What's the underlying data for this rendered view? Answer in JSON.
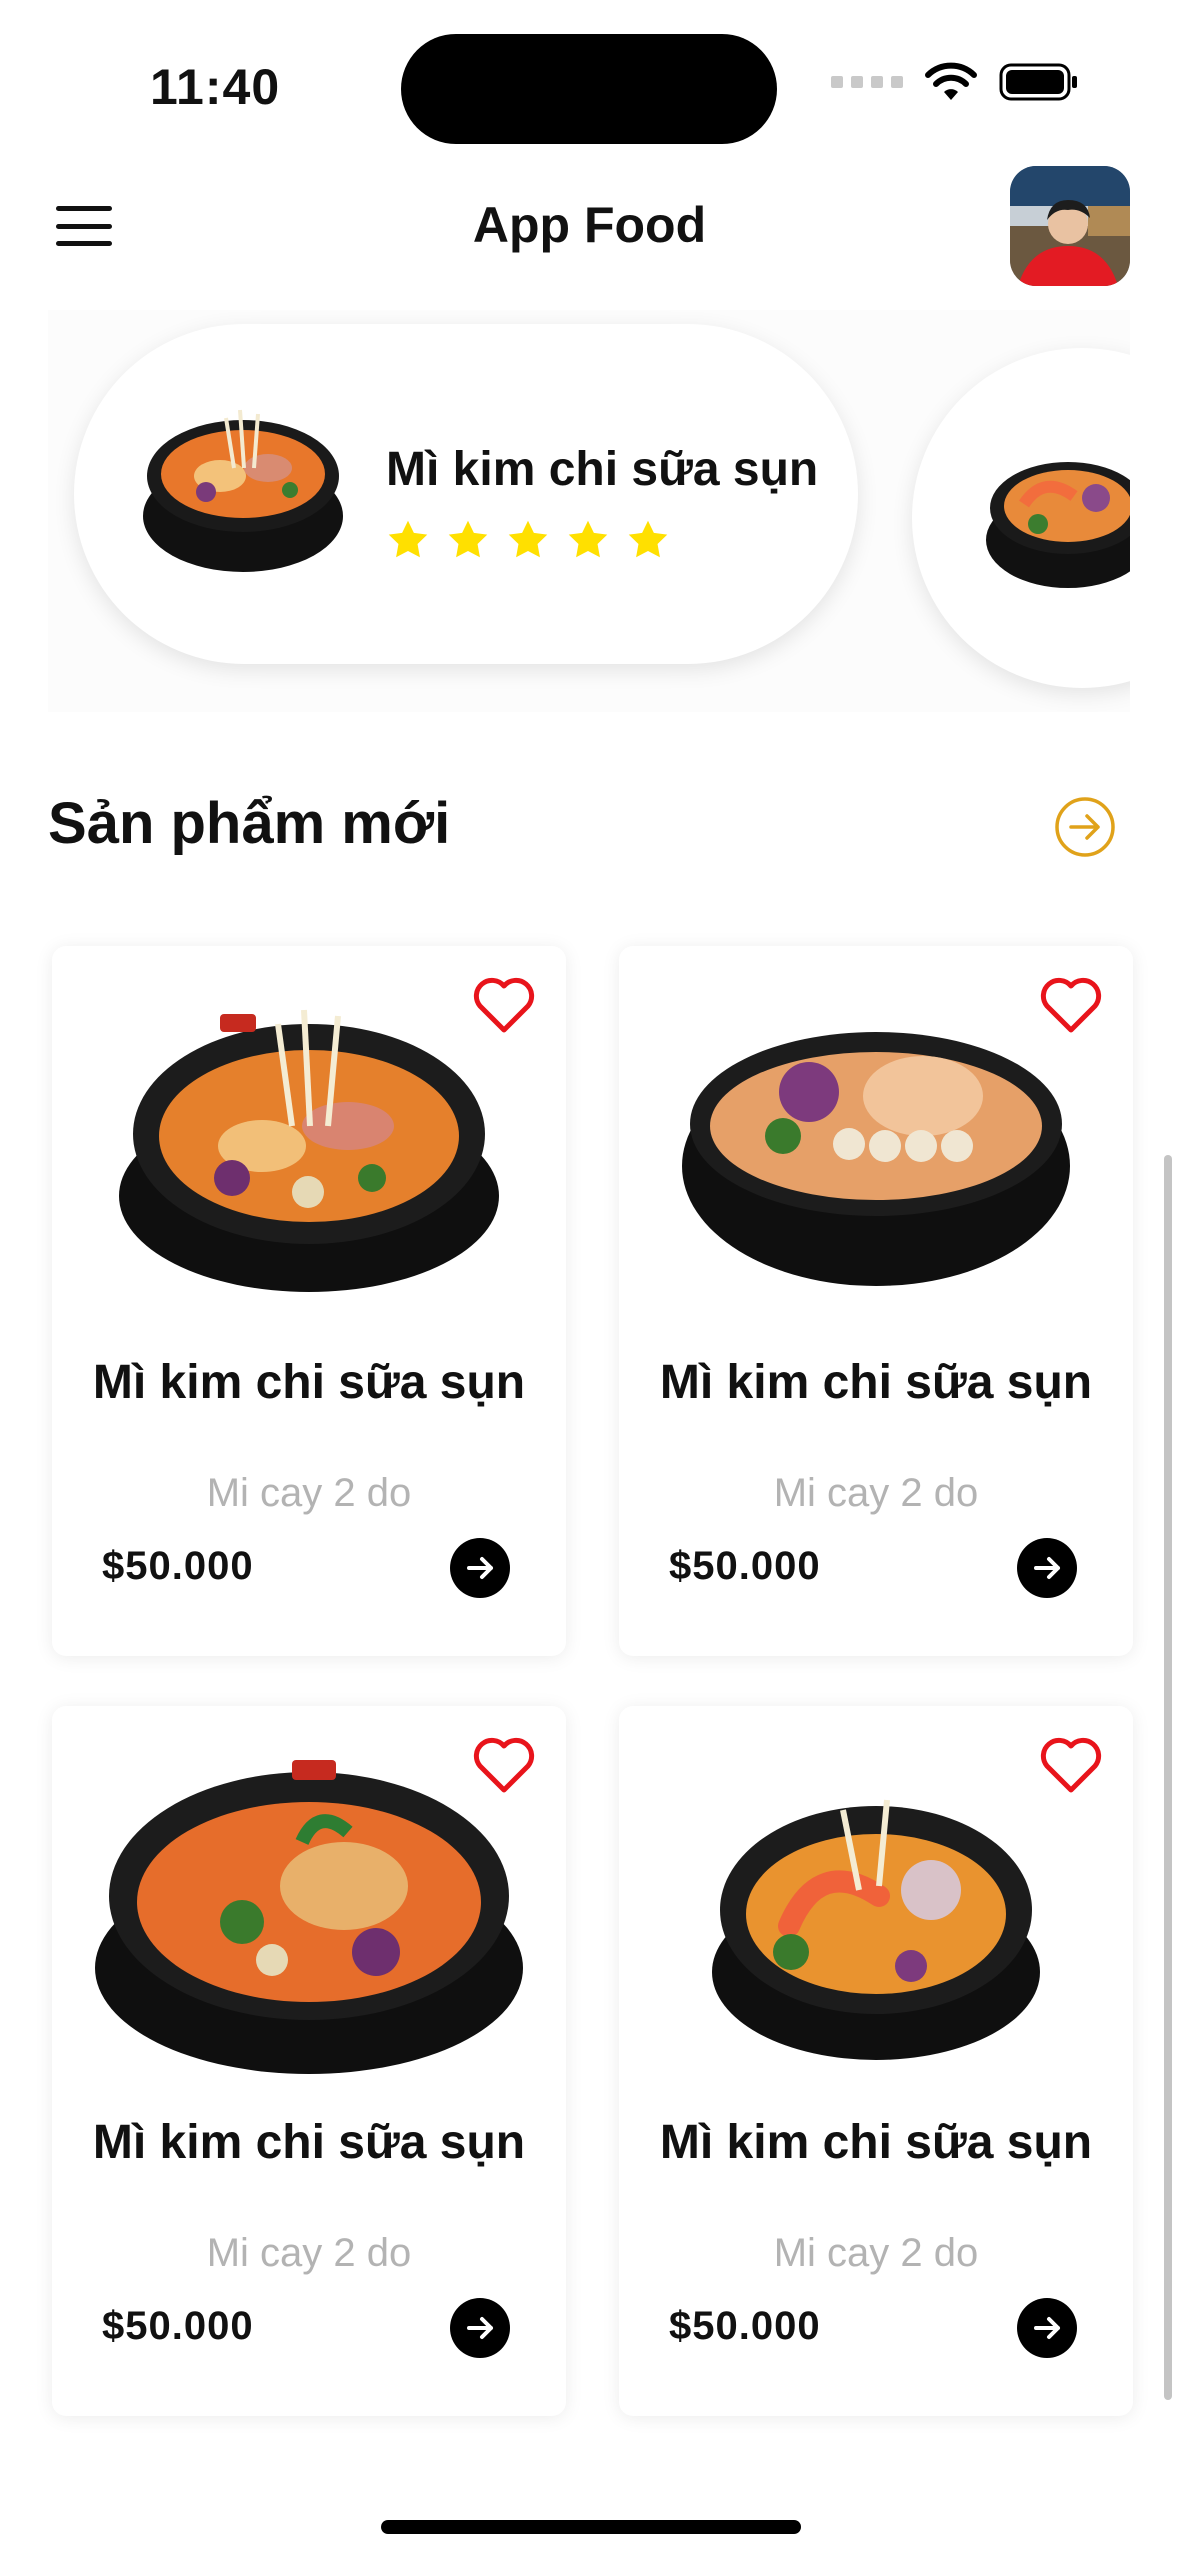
{
  "status_bar": {
    "time": "11:40"
  },
  "header": {
    "title": "App Food"
  },
  "featured": [
    {
      "name": "Mì kim chi sữa sụn",
      "rating": 5
    },
    {
      "name": "",
      "rating": 0
    }
  ],
  "section": {
    "title": "Sản phẩm mới"
  },
  "products": [
    {
      "name": "Mì kim chi sữa sụn",
      "subtitle": "Mi cay 2 do",
      "price": "$50.000"
    },
    {
      "name": "Mì kim chi sữa sụn",
      "subtitle": "Mi cay 2 do",
      "price": "$50.000"
    },
    {
      "name": "Mì kim chi sữa sụn",
      "subtitle": "Mi cay 2 do",
      "price": "$50.000"
    },
    {
      "name": "Mì kim chi sữa sụn",
      "subtitle": "Mi cay 2 do",
      "price": "$50.000"
    }
  ],
  "colors": {
    "accent": "#E0A21A",
    "heart": "#E8141B",
    "star": "#FFE000",
    "muted_text": "#B3B3B3"
  },
  "icons": [
    "menu-icon",
    "wifi-icon",
    "battery-icon",
    "star-icon",
    "arrow-circle-right-icon",
    "heart-icon",
    "arrow-right-icon"
  ]
}
